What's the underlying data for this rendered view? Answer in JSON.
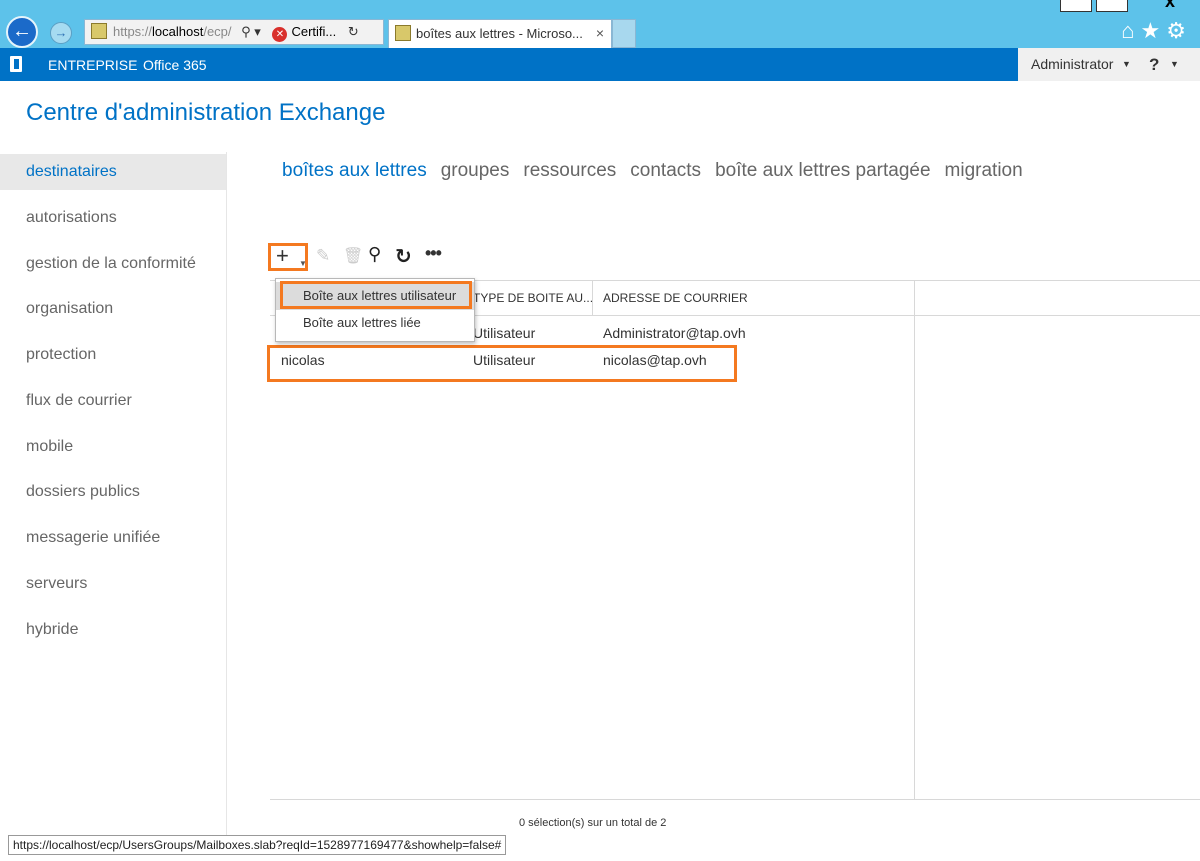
{
  "browser": {
    "url_prefix": "https://",
    "url_host": "localhost",
    "url_suffix": "/ecp/",
    "cert_label": "Certifi...",
    "tab_title": "boîtes aux lettres - Microso...",
    "tab_close": "×"
  },
  "header": {
    "brand": "ENTREPRISE",
    "office": "Office 365",
    "user": "Administrator",
    "help": "?"
  },
  "app_title": "Centre d'administration Exchange",
  "sidebar": {
    "items": [
      {
        "label": "destinataires"
      },
      {
        "label": "autorisations"
      },
      {
        "label": "gestion de la conformité"
      },
      {
        "label": "organisation"
      },
      {
        "label": "protection"
      },
      {
        "label": "flux de courrier"
      },
      {
        "label": "mobile"
      },
      {
        "label": "dossiers publics"
      },
      {
        "label": "messagerie unifiée"
      },
      {
        "label": "serveurs"
      },
      {
        "label": "hybride"
      }
    ],
    "active_index": 0
  },
  "subtabs": [
    {
      "label": "boîtes aux lettres"
    },
    {
      "label": "groupes"
    },
    {
      "label": "ressources"
    },
    {
      "label": "contacts"
    },
    {
      "label": "boîte aux lettres partagée"
    },
    {
      "label": "migration"
    }
  ],
  "toolbar": {
    "add_icon": "plus-icon",
    "edit_icon": "pencil-icon",
    "delete_icon": "trash-icon",
    "search_icon": "search-icon",
    "refresh_icon": "refresh-icon",
    "more_icon": "ellipsis-icon"
  },
  "add_menu": {
    "items": [
      {
        "label": "Boîte aux lettres utilisateur"
      },
      {
        "label": "Boîte aux lettres liée"
      }
    ]
  },
  "grid": {
    "columns": [
      "TYPE DE BOITE AU...",
      "ADRESSE DE COURRIER"
    ],
    "rows": [
      {
        "name": "",
        "type": "Utilisateur",
        "email": "Administrator@tap.ovh"
      },
      {
        "name": "nicolas",
        "type": "Utilisateur",
        "email": "nicolas@tap.ovh"
      }
    ]
  },
  "footer": {
    "selection": "0 sélection(s) sur un total de 2",
    "status_url": "https://localhost/ecp/UsersGroups/Mailboxes.slab?reqId=1528977169477&showhelp=false#"
  },
  "colors": {
    "accent": "#0072c6",
    "highlight": "#f47920",
    "chrome": "#5dc2ea"
  }
}
